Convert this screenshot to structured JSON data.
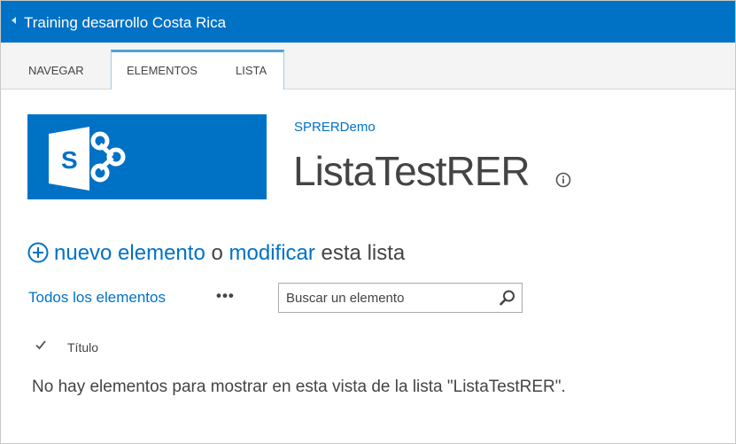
{
  "suite_bar": {
    "title": "Training desarrollo Costa Rica",
    "color": "#0072c6"
  },
  "ribbon": {
    "tabs": [
      {
        "label": "NAVEGAR"
      },
      {
        "label": "ELEMENTOS"
      },
      {
        "label": "LISTA"
      }
    ]
  },
  "site": {
    "logo_icon": "sharepoint-logo-icon",
    "link_text": "SPRERDemo",
    "page_title": "ListaTestRER",
    "title_info_icon": "info-icon"
  },
  "new_item": {
    "icon": "plus-circle-icon",
    "new_label": "nuevo elemento",
    "connector": "o",
    "edit_label": "modificar",
    "tail_text": "esta lista"
  },
  "views": {
    "current_view": "Todos los elementos",
    "more_label": "•••",
    "search_placeholder": "Buscar un elemento",
    "search_icon": "search-icon"
  },
  "list": {
    "select_icon": "checkmark-icon",
    "columns": [
      {
        "label": "Título"
      }
    ],
    "empty_message": "No hay elementos para mostrar en esta vista de la lista \"ListaTestRER\"."
  }
}
